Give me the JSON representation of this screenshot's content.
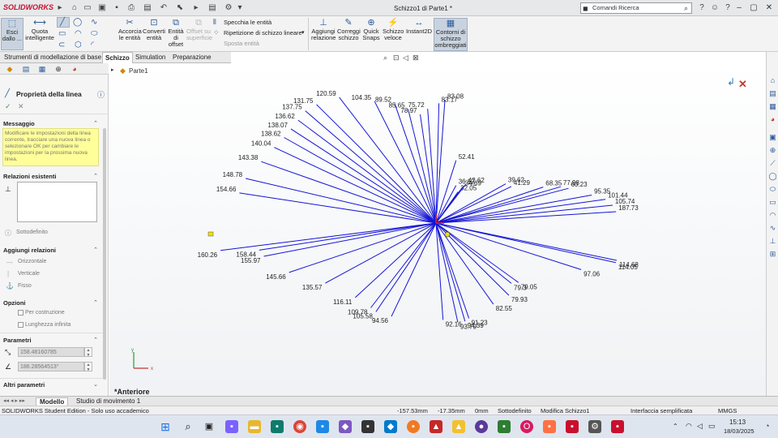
{
  "app": {
    "logo": "SOLIDWORKS",
    "title": "Schizzo1 di Parte1 *"
  },
  "search": {
    "placeholder": "Comandi Ricerca"
  },
  "ribbon": {
    "esci": "Esci dallo ...",
    "quota": "Quota intelligente",
    "accorcia": "Accorcia le entità",
    "converti": "Converti entità",
    "offset": "Entità di offset",
    "offset_sup": "Offset su superficie",
    "specchia": "Specchia le entità",
    "ripetizione": "Ripetizione di schizzo lineare",
    "sposta": "Sposta entità",
    "aggiungi": "Aggiungi relazione",
    "correggi": "Correggi schizzo",
    "quick": "Quick Snaps",
    "veloce": "Schizzo veloce",
    "instant": "Instant2D",
    "contorni": "Contorni di schizzo ombreggiati"
  },
  "tabs": [
    "Strumenti di modellazione di base",
    "Schizzo",
    "Simulation",
    "Preparazione analisi"
  ],
  "active_tab": "Schizzo",
  "panel": {
    "title": "Proprietà della linea",
    "messaggio_h": "Messaggio",
    "messaggio": "Modificare le impostazioni della linea corrente, tracciare una nuova linea o selezionare OK per cambiare le impostazioni per la prossima nuova linea.",
    "relazioni_h": "Relazioni esistenti",
    "sottodefinito": "Sottodefinito",
    "aggiungi_h": "Aggiungi relazioni",
    "orizzontale": "Orizzontale",
    "verticale": "Verticale",
    "fisso": "Fisso",
    "opzioni_h": "Opzioni",
    "costruzione": "Per costruzione",
    "infinita": "Lunghezza infinita",
    "parametri_h": "Parametri",
    "lunghezza": "158.48160785",
    "angolo": "186.28564513°",
    "altri_h": "Altri parametri"
  },
  "tree": {
    "part": "Parte1"
  },
  "view_label": "*Anteriore",
  "bottom_tabs": [
    "Modello",
    "Studio di movimento 1"
  ],
  "status": {
    "edition": "SOLIDWORKS Student Edition - Solo uso accademico",
    "x": "-157.53mm",
    "y": "-17.35mm",
    "z": "0mm",
    "state": "Sottodefinito",
    "editing": "Modifica Schizzo1",
    "interface": "Interfaccia semplificata",
    "units": "MMGS"
  },
  "clock": {
    "time": "15:13",
    "date": "18/03/2025"
  },
  "dims": [
    {
      "t": "52.41",
      "a": 77,
      "r": 110
    },
    {
      "t": "36.12",
      "a": 69,
      "r": 69
    },
    {
      "t": "32.05",
      "a": 63,
      "r": 60
    },
    {
      "t": "34.69",
      "a": 62,
      "r": 70
    },
    {
      "t": "42.62",
      "a": 61,
      "r": 76
    },
    {
      "t": "39.62",
      "a": 38,
      "r": 109
    },
    {
      "t": "41.29",
      "a": 34,
      "r": 112
    },
    {
      "t": "68.35",
      "a": 25,
      "r": 146
    },
    {
      "t": "77.98",
      "a": 22,
      "r": 166
    },
    {
      "t": "60.23",
      "a": 20,
      "r": 174
    },
    {
      "t": "95.35",
      "a": 14,
      "r": 198
    },
    {
      "t": "101.44",
      "a": 11,
      "r": 213
    },
    {
      "t": "105.74",
      "a": 8,
      "r": 220
    },
    {
      "t": "187.73",
      "a": 5,
      "r": 223
    },
    {
      "t": "114.68",
      "a": -16,
      "r": 232
    },
    {
      "t": "114.05",
      "a": -17,
      "r": 232
    },
    {
      "t": "97.06",
      "a": -24,
      "r": 196
    },
    {
      "t": "79.05",
      "a": -45,
      "r": 144
    },
    {
      "t": "79.3",
      "a": -48,
      "r": 139
    },
    {
      "t": "79.93",
      "a": -54,
      "r": 153
    },
    {
      "t": "82.55",
      "a": -63,
      "r": 156
    },
    {
      "t": "91.23",
      "a": -76,
      "r": 168
    },
    {
      "t": "94.39",
      "a": -78,
      "r": 172
    },
    {
      "t": "93.79",
      "a": -81,
      "r": 172
    },
    {
      "t": "92.16",
      "a": -87,
      "r": 166
    },
    {
      "t": "94.56",
      "a": -109,
      "r": 169
    },
    {
      "t": "105.58",
      "a": -116,
      "r": 169
    },
    {
      "t": "109.78",
      "a": -119,
      "r": 166
    },
    {
      "t": "116.11",
      "a": -128,
      "r": 162
    },
    {
      "t": "135.57",
      "a": -143,
      "r": 171
    },
    {
      "t": "145.66",
      "a": -155,
      "r": 200
    },
    {
      "t": "155.97",
      "a": -165,
      "r": 220
    },
    {
      "t": "158.44",
      "a": -168,
      "r": 223
    },
    {
      "t": "160.26",
      "a": -170,
      "r": 270
    },
    {
      "t": "154.66",
      "a": 168,
      "r": 248
    },
    {
      "t": "148.78",
      "a": 162,
      "r": 247
    },
    {
      "t": "143.38",
      "a": 154,
      "r": 240
    },
    {
      "t": "140.04",
      "a": 147,
      "r": 238
    },
    {
      "t": "138.62",
      "a": 142,
      "r": 238
    },
    {
      "t": "138.07",
      "a": 138,
      "r": 241
    },
    {
      "t": "136.62",
      "a": 134,
      "r": 245
    },
    {
      "t": "137.75",
      "a": 130,
      "r": 251
    },
    {
      "t": "131.75",
      "a": 126,
      "r": 251
    },
    {
      "t": "120.59",
      "a": 119,
      "r": 246
    },
    {
      "t": "104.35",
      "a": 110,
      "r": 222
    },
    {
      "t": "89.52",
      "a": 104,
      "r": 211
    },
    {
      "t": "85.65",
      "a": 100,
      "r": 198
    },
    {
      "t": "78.97",
      "a": 96,
      "r": 187
    },
    {
      "t": "75.72",
      "a": 93,
      "r": 196
    },
    {
      "t": "83.17",
      "a": 89,
      "r": 205
    },
    {
      "t": "83.08",
      "a": 87,
      "r": 211
    }
  ]
}
